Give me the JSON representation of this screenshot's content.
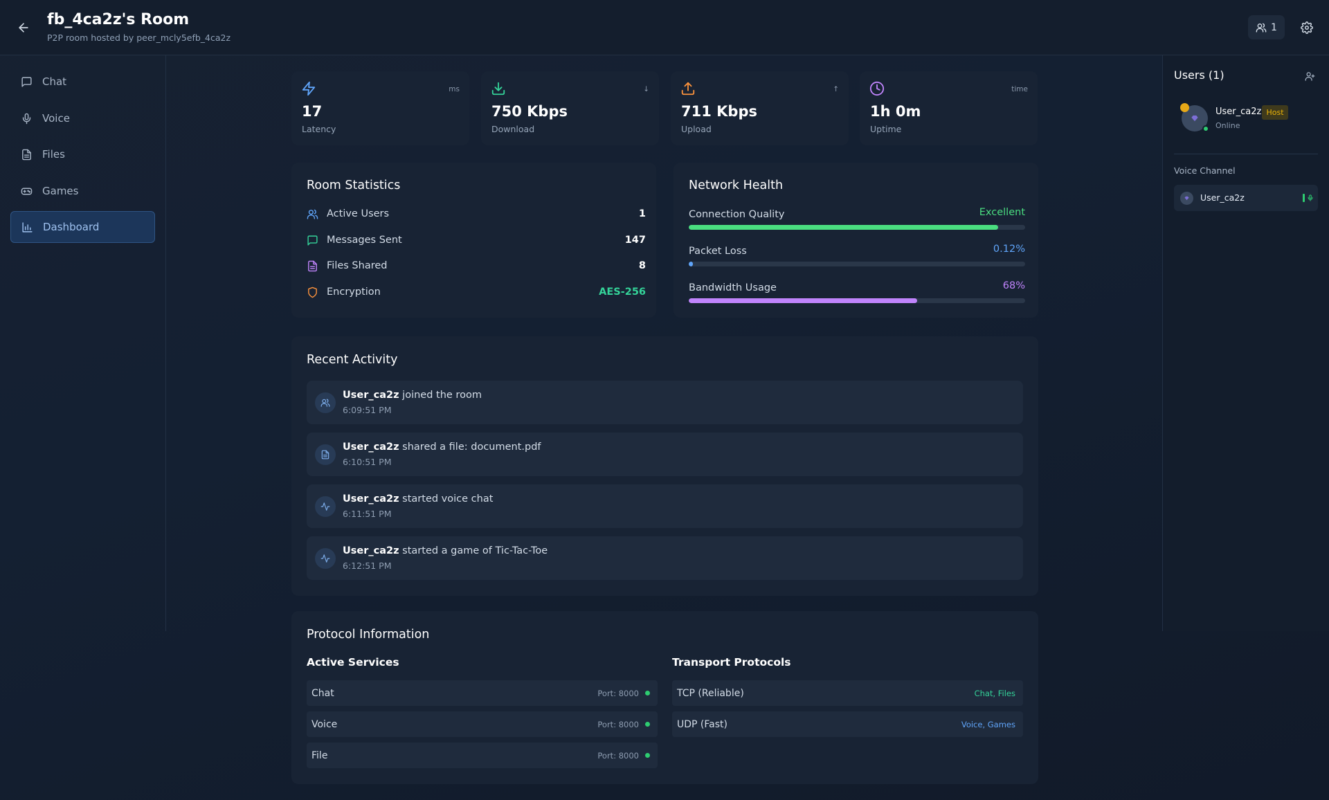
{
  "header": {
    "title": "fb_4ca2z's Room",
    "subtitle": "P2P room hosted by peer_mcly5efb_4ca2z",
    "user_count": "1"
  },
  "sidebar": {
    "items": [
      {
        "label": "Chat",
        "icon": "message-square-icon"
      },
      {
        "label": "Voice",
        "icon": "mic-icon"
      },
      {
        "label": "Files",
        "icon": "file-text-icon"
      },
      {
        "label": "Games",
        "icon": "gamepad-icon"
      },
      {
        "label": "Dashboard",
        "icon": "bar-chart-icon",
        "active": true
      }
    ]
  },
  "metrics": [
    {
      "icon": "zap-icon",
      "unit": "ms",
      "value": "17",
      "label": "Latency",
      "color": "#60a5fa"
    },
    {
      "icon": "download-icon",
      "unit": "↓",
      "value": "750 Kbps",
      "label": "Download",
      "color": "#34d399"
    },
    {
      "icon": "upload-icon",
      "unit": "↑",
      "value": "711 Kbps",
      "label": "Upload",
      "color": "#fb923c"
    },
    {
      "icon": "clock-icon",
      "unit": "time",
      "value": "1h 0m",
      "label": "Uptime",
      "color": "#c084fc"
    }
  ],
  "room_stats": {
    "title": "Room Statistics",
    "rows": [
      {
        "label": "Active Users",
        "value": "1",
        "icon": "users-icon",
        "icon_color": "#60a5fa",
        "value_color": "#ffffff"
      },
      {
        "label": "Messages Sent",
        "value": "147",
        "icon": "message-square-icon",
        "icon_color": "#34d399",
        "value_color": "#ffffff"
      },
      {
        "label": "Files Shared",
        "value": "8",
        "icon": "file-text-icon",
        "icon_color": "#c084fc",
        "value_color": "#ffffff"
      },
      {
        "label": "Encryption",
        "value": "AES-256",
        "icon": "shield-icon",
        "icon_color": "#fb923c",
        "value_color": "#34d399"
      }
    ]
  },
  "network_health": {
    "title": "Network Health",
    "rows": [
      {
        "label": "Connection Quality",
        "value": "Excellent",
        "fraction": 0.92,
        "color": "#4ade80"
      },
      {
        "label": "Packet Loss",
        "value": "0.12%",
        "fraction": 0.012,
        "color": "#60a5fa"
      },
      {
        "label": "Bandwidth Usage",
        "value": "68%",
        "fraction": 0.68,
        "color": "#c084fc"
      }
    ]
  },
  "recent_activity": {
    "title": "Recent Activity",
    "items": [
      {
        "user": "User_ca2z",
        "action": "joined the room",
        "time": "6:09:51 PM",
        "icon": "users-icon"
      },
      {
        "user": "User_ca2z",
        "action": "shared a file: document.pdf",
        "time": "6:10:51 PM",
        "icon": "file-text-icon"
      },
      {
        "user": "User_ca2z",
        "action": "started voice chat",
        "time": "6:11:51 PM",
        "icon": "activity-icon"
      },
      {
        "user": "User_ca2z",
        "action": "started a game of Tic-Tac-Toe",
        "time": "6:12:51 PM",
        "icon": "activity-icon"
      }
    ]
  },
  "protocol": {
    "title": "Protocol Information",
    "services_title": "Active Services",
    "services": [
      {
        "name": "Chat",
        "port": "Port: 8000"
      },
      {
        "name": "Voice",
        "port": "Port: 8000"
      },
      {
        "name": "File",
        "port": "Port: 8000"
      }
    ],
    "transport_title": "Transport Protocols",
    "transports": [
      {
        "name": "TCP (Reliable)",
        "tags": "Chat, Files",
        "color": "#34d399"
      },
      {
        "name": "UDP (Fast)",
        "tags": "Voice, Games",
        "color": "#60a5fa"
      }
    ]
  },
  "users_panel": {
    "title": "Users (1)",
    "user": {
      "name": "User_ca2z",
      "badge": "Host",
      "status": "Online"
    },
    "voice_channel_title": "Voice Channel",
    "voice_user": "User_ca2z"
  }
}
